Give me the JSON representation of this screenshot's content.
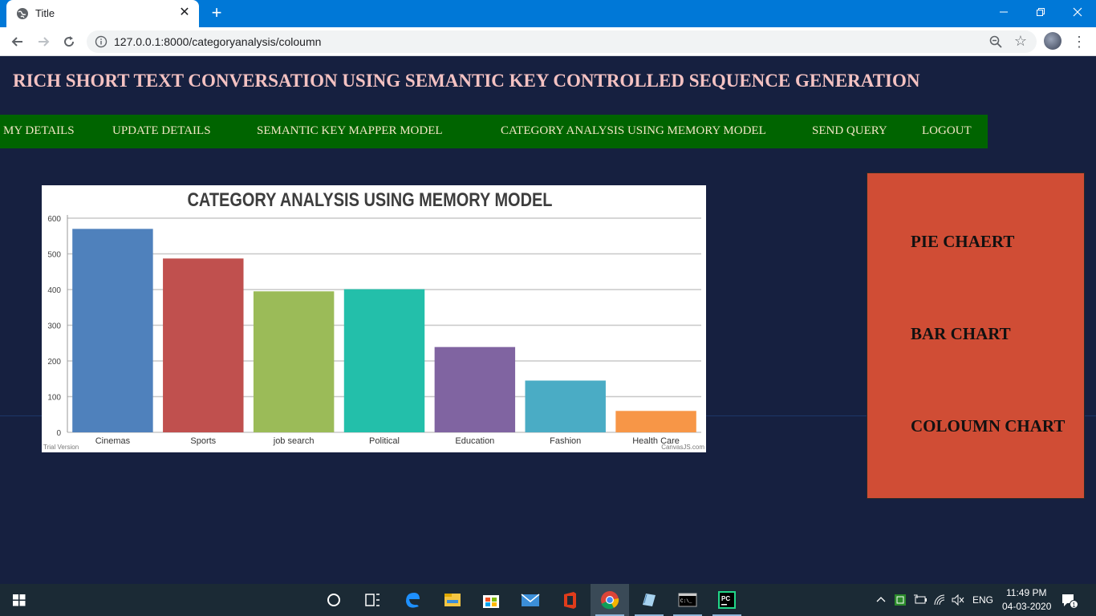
{
  "browser": {
    "tab_title": "Title",
    "tab_close": "✕",
    "new_tab": "+",
    "url": "127.0.0.1:8000/categoryanalysis/coloumn",
    "icons": [
      "globe-icon",
      "back-icon",
      "forward-icon",
      "reload-icon",
      "info-icon",
      "zoom-out-icon",
      "star-icon",
      "profile-avatar",
      "kebab-menu-icon",
      "minimize-icon",
      "restore-icon",
      "close-icon"
    ],
    "accent": "#0078d7"
  },
  "page": {
    "title": "RICH SHORT TEXT CONVERSATION USING SEMANTIC KEY CONTROLLED SEQUENCE GENERATION",
    "nav": [
      "MY DETAILS",
      "UPDATE DETAILS",
      "SEMANTIC KEY MAPPER MODEL",
      "CATEGORY ANALYSIS USING MEMORY MODEL",
      "SEND QUERY",
      "LOGOUT"
    ],
    "side_panel": [
      "PIE CHAERT",
      "BAR CHART",
      "COLOUMN CHART"
    ],
    "colors": {
      "background": "#162040",
      "title": "#f4c2c2",
      "nav_bg": "#006400",
      "panel_bg": "#d04d35"
    }
  },
  "chart_data": {
    "type": "bar",
    "title": "CATEGORY ANALYSIS USING MEMORY MODEL",
    "categories": [
      "Cinemas",
      "Sports",
      "job search",
      "Political",
      "Education",
      "Fashion",
      "Health Care"
    ],
    "values": [
      570,
      487,
      395,
      401,
      239,
      145,
      60
    ],
    "colors": [
      "#4f81bc",
      "#c0504e",
      "#9bbb58",
      "#23bfaa",
      "#8064a1",
      "#4aacc5",
      "#f79647"
    ],
    "ylim": [
      0,
      600
    ],
    "yticks": [
      0,
      100,
      200,
      300,
      400,
      500,
      600
    ],
    "grid": true,
    "footer_left": "Trial Version",
    "footer_right": "CanvasJS.com"
  },
  "taskbar": {
    "icons": [
      "windows-start-icon",
      "cortana-icon",
      "task-view-icon",
      "edge-icon",
      "file-explorer-icon",
      "store-icon",
      "mail-icon",
      "office-icon",
      "chrome-icon",
      "notepad-icon",
      "terminal-icon",
      "pycharm-icon"
    ],
    "language": "ENG",
    "time": "11:49 PM",
    "date": "04-03-2020",
    "notifications": "1"
  }
}
